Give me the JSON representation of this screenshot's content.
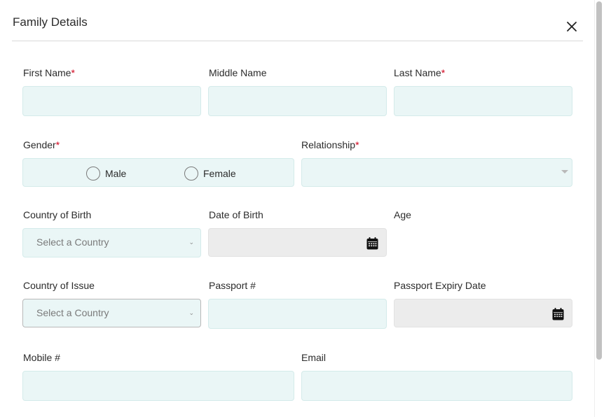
{
  "modal": {
    "title": "Family Details",
    "close_icon": "close-icon"
  },
  "form": {
    "required_marker": "*",
    "first_name": {
      "label": "First Name",
      "required": true,
      "value": ""
    },
    "middle_name": {
      "label": "Middle Name",
      "required": false,
      "value": ""
    },
    "last_name": {
      "label": "Last Name",
      "required": true,
      "value": ""
    },
    "gender": {
      "label": "Gender",
      "required": true,
      "options": [
        "Male",
        "Female"
      ],
      "selected": null
    },
    "relationship": {
      "label": "Relationship",
      "required": true,
      "value": ""
    },
    "country_of_birth": {
      "label": "Country of Birth",
      "placeholder": "Select a Country"
    },
    "date_of_birth": {
      "label": "Date of Birth",
      "value": "",
      "icon": "calendar-icon"
    },
    "age": {
      "label": "Age",
      "value": ""
    },
    "country_of_issue": {
      "label": "Country of Issue",
      "placeholder": "Select a Country"
    },
    "passport_number": {
      "label": "Passport #",
      "value": ""
    },
    "passport_expiry": {
      "label": "Passport Expiry Date",
      "value": "",
      "icon": "calendar-icon"
    },
    "mobile": {
      "label": "Mobile #",
      "value": ""
    },
    "email": {
      "label": "Email",
      "value": ""
    }
  },
  "colors": {
    "field_bg": "#eaf6f6",
    "disabled_bg": "#ececec",
    "required": "#d0021b",
    "text": "#2b2b2b"
  }
}
